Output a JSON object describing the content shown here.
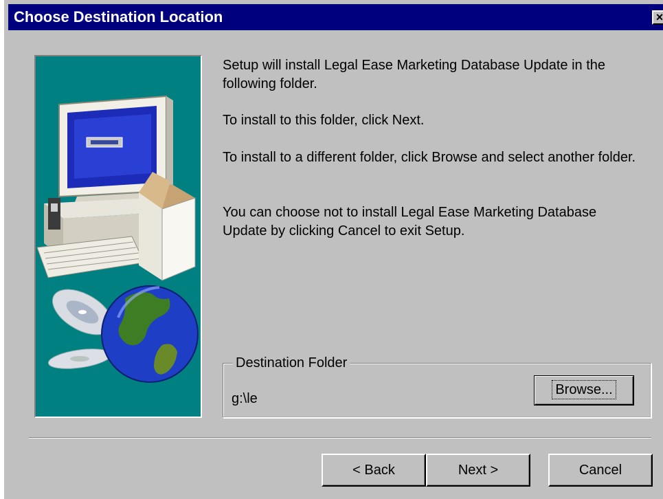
{
  "window": {
    "title": "Choose Destination Location",
    "close_label": "×"
  },
  "messages": [
    "Setup will install Legal Ease Marketing Database Update in the following folder.",
    "To install to this folder, click Next.",
    "To install to a different folder, click Browse and select another folder.",
    "You can choose not to install Legal Ease Marketing Database Update by clicking Cancel to exit Setup."
  ],
  "destination": {
    "legend": "Destination Folder",
    "path": "g:\\le",
    "browse_label": "Browse..."
  },
  "buttons": {
    "back_label": "< Back",
    "next_label": "Next >",
    "cancel_label": "Cancel"
  },
  "colors": {
    "title_bar": "#00007f",
    "illustration_bg": "#008080",
    "dialog_face": "#c0c0c0"
  }
}
